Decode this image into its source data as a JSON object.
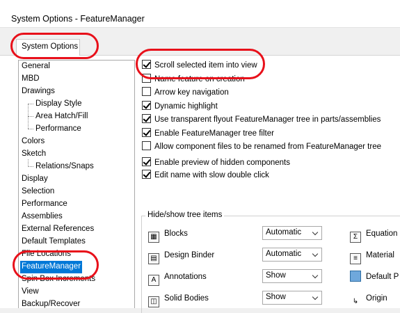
{
  "window": {
    "title": "System Options - FeatureManager"
  },
  "tab": {
    "label": "System Options"
  },
  "tree": {
    "items": [
      {
        "label": "General"
      },
      {
        "label": "MBD"
      },
      {
        "label": "Drawings"
      },
      {
        "label": "Display Style"
      },
      {
        "label": "Area Hatch/Fill"
      },
      {
        "label": "Performance"
      },
      {
        "label": "Colors"
      },
      {
        "label": "Sketch"
      },
      {
        "label": "Relations/Snaps"
      },
      {
        "label": "Display"
      },
      {
        "label": "Selection"
      },
      {
        "label": "Performance"
      },
      {
        "label": "Assemblies"
      },
      {
        "label": "External References"
      },
      {
        "label": "Default Templates"
      },
      {
        "label": "File Locations"
      },
      {
        "label": "FeatureManager"
      },
      {
        "label": "Spin Box Increments"
      },
      {
        "label": "View"
      },
      {
        "label": "Backup/Recover"
      }
    ],
    "selected": "FeatureManager"
  },
  "options": [
    {
      "label": "Scroll selected item into view",
      "checked": true
    },
    {
      "label": "Name feature on creation",
      "checked": false
    },
    {
      "label": "Arrow key navigation",
      "checked": false
    },
    {
      "label": "Dynamic highlight",
      "checked": true
    },
    {
      "label": "Use transparent flyout FeatureManager tree in parts/assemblies",
      "checked": true
    },
    {
      "label": "Enable FeatureManager tree filter",
      "checked": true
    },
    {
      "label": "Allow component files to be renamed from FeatureManager tree",
      "checked": false
    },
    {
      "label": "Enable preview of hidden components",
      "checked": true
    },
    {
      "label": "Edit name with slow double click",
      "checked": true
    }
  ],
  "hide_show": {
    "label": "Hide/show tree items",
    "rows": [
      {
        "label": "Blocks",
        "icon": "blocks-icon",
        "value": "Automatic"
      },
      {
        "label": "Design Binder",
        "icon": "design-binder-icon",
        "value": "Automatic"
      },
      {
        "label": "Annotations",
        "icon": "annotations-icon",
        "value": "Show"
      },
      {
        "label": "Solid Bodies",
        "icon": "solid-bodies-icon",
        "value": "Show"
      }
    ],
    "right_items": [
      {
        "label": "Equation",
        "icon": "equation-icon"
      },
      {
        "label": "Material",
        "icon": "material-icon"
      },
      {
        "label": "Default P",
        "icon": "default-planes-icon"
      },
      {
        "label": "Origin",
        "icon": "origin-icon"
      }
    ]
  },
  "highlight_color": "#e8101a",
  "selection_color": "#0078d7"
}
